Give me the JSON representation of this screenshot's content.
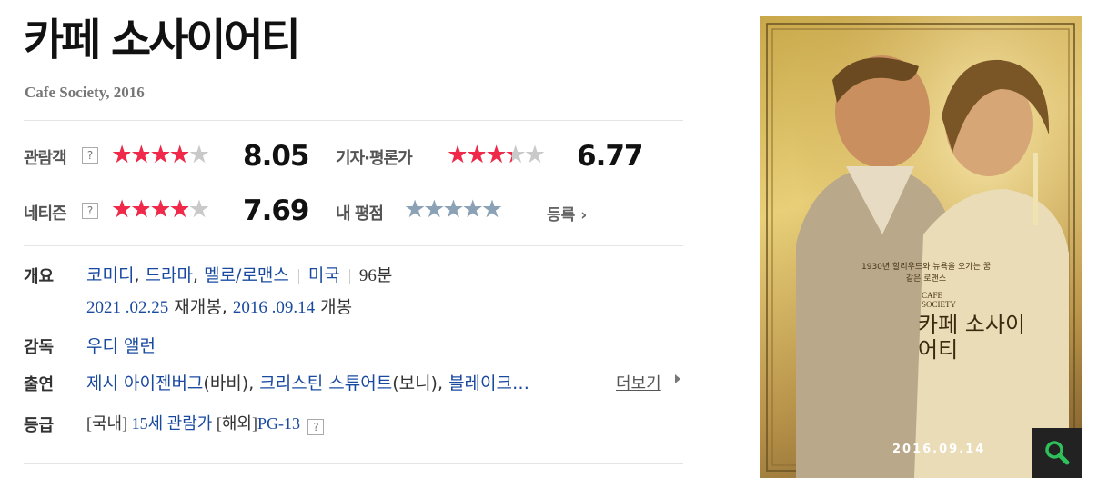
{
  "movie": {
    "title": "카페 소사이어티",
    "subtitle": "Cafe Society, 2016"
  },
  "ratings": {
    "audience": {
      "label": "관람객",
      "score": "8.05",
      "stars": 4.0
    },
    "critic": {
      "label": "기자·평론가",
      "score": "6.77",
      "stars": 3.4
    },
    "netizen": {
      "label": "네티즌",
      "score": "7.69",
      "stars": 4.0
    },
    "mine": {
      "label": "내 평점",
      "register": "등록"
    },
    "help": "?"
  },
  "info": {
    "overview_label": "개요",
    "genres": [
      "코미디",
      "드라마",
      "멜로/로맨스"
    ],
    "country": "미국",
    "runtime": "96분",
    "rerelease_date": "2021 .02.25",
    "rerelease_text": "재개봉",
    "release_date": "2016 .09.14",
    "release_text": "개봉",
    "director_label": "감독",
    "director": "우디 앨런",
    "cast_label": "출연",
    "cast": [
      {
        "name": "제시 아이젠버그",
        "role": "(바비)"
      },
      {
        "name": "크리스틴 스튜어트",
        "role": "(보니)"
      },
      {
        "name": "블레이크…",
        "role": ""
      }
    ],
    "more": "더보기",
    "grade_label": "등급",
    "grade_domestic_prefix": "[국내]",
    "grade_domestic": "15세 관람가",
    "grade_overseas_prefix": "[해외]",
    "grade_overseas": "PG-13"
  },
  "poster": {
    "tagline": "1930년 할리우드와 뉴욕을 오가는 꿈 같은 로맨스",
    "small_title": "CAFE SOCIETY",
    "title": "카페 소사이어티",
    "date": "2016.09.14"
  },
  "icons": {
    "zoom": "magnifier-icon",
    "arrow": "chevron-right-icon"
  },
  "colors": {
    "star_on": "#f0294a",
    "star_off": "#c9c9c9",
    "link": "#1a4aa0"
  }
}
